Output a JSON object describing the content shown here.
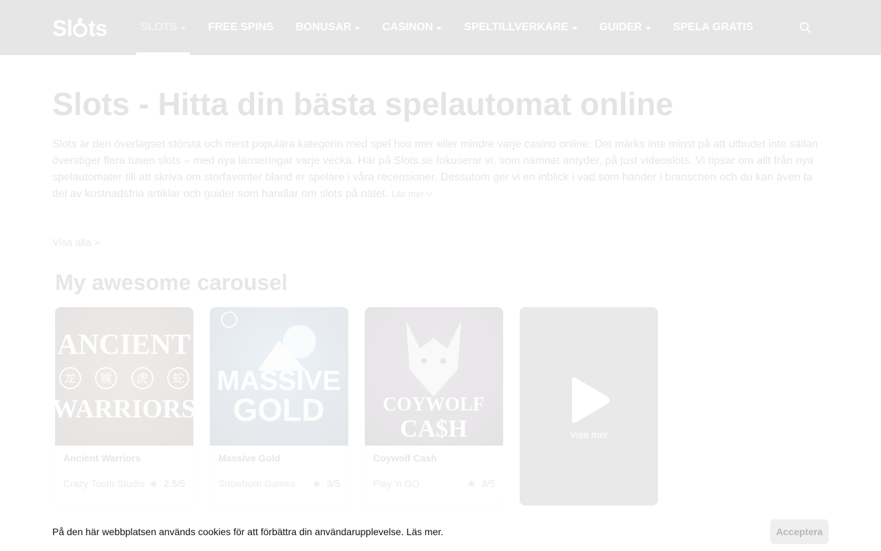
{
  "brand": {
    "logo_text_1": "Sl",
    "logo_text_2": "ts"
  },
  "nav": [
    {
      "label": "SLOTS",
      "dropdown": true,
      "active": true
    },
    {
      "label": "FREE SPINS",
      "dropdown": false
    },
    {
      "label": "BONUSAR",
      "dropdown": true
    },
    {
      "label": "CASINON",
      "dropdown": true
    },
    {
      "label": "SPELTILLVERKARE",
      "dropdown": true
    },
    {
      "label": "GUIDER",
      "dropdown": true
    },
    {
      "label": "SPELA GRATIS",
      "dropdown": false
    }
  ],
  "page": {
    "title": "Slots - Hitta din bästa spelautomat online",
    "intro": "Slots är den överlägset största och mest populära kategorin med spel hos mer eller mindre varje casino online. Det märks inte minst på att utbudet inte sällan överstiger flera tusen slots – med nya lanseringar varje vecka. Här på Slots.se fokuserar vi, som namnet antyder, på just videoslots. Vi tipsar om allt från nya spelautomater till att skriva om storfavoriter bland er spelare i våra recensioner. Dessutom ger vi en inblick i vad som händer i branschen och du kan även ta del av kostnadsfria artiklar och guider som handlar om slots på nätet.",
    "read_more": "Läs mer",
    "view_all": "Visa alla >"
  },
  "carousel": {
    "title": "My awesome carousel",
    "cards": [
      {
        "name": "Ancient Warriors",
        "provider": "Crazy Tooth Studio",
        "rating": "2.5/5",
        "art_top": "ANCIENT",
        "art_bottom": "WARRIORS",
        "art_glyphs": [
          "龙",
          "猴",
          "虎",
          "蛇"
        ]
      },
      {
        "name": "Massive Gold",
        "provider": "Snowborn Games",
        "rating": "3/5",
        "art_top": "MASSIVE",
        "art_bottom": "GOLD"
      },
      {
        "name": "Coywolf Cash",
        "provider": "Play 'n GO",
        "rating": "3/5",
        "art_top": "COYWOLF",
        "art_bottom": "CA$H"
      }
    ],
    "more_label": "Visa mer"
  },
  "cookie": {
    "text": "På den här webbplatsen används cookies för att förbättra din användarupplevelse.",
    "link": "Läs mer.",
    "accept": "Acceptera"
  },
  "colors": {
    "header_bg": "#1e1e1e",
    "overlay": "rgba(255,255,255,0.89)"
  },
  "icons": {
    "search": "search-icon",
    "star": "star-icon",
    "play": "play-icon"
  }
}
